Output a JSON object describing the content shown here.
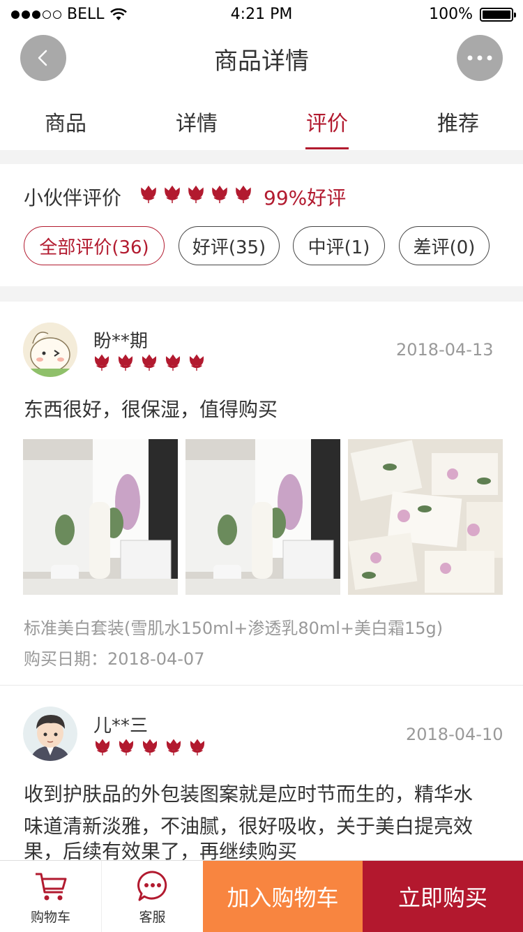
{
  "status_bar": {
    "carrier": "BELL",
    "time": "4:21 PM",
    "battery": "100%"
  },
  "nav": {
    "title": "商品详情"
  },
  "tabs": [
    {
      "label": "商品"
    },
    {
      "label": "详情"
    },
    {
      "label": "评价",
      "active": true
    },
    {
      "label": "推荐"
    }
  ],
  "summary": {
    "label": "小伙伴评价",
    "rating": 5,
    "good_rate": "99%好评"
  },
  "filters": [
    {
      "label": "全部评价(36)",
      "active": true
    },
    {
      "label": "好评(35)"
    },
    {
      "label": "中评(1)"
    },
    {
      "label": "差评(0)"
    }
  ],
  "reviews": [
    {
      "name": "盼**期",
      "date": "2018-04-13",
      "rating": 5,
      "text": "东西很好，很保湿，值得购买",
      "spec": "标准美白套装(雪肌水150ml+渗透乳80ml+美白霜15g)",
      "purchase_date": "购买日期：2018-04-07"
    },
    {
      "name": "儿**三",
      "date": "2018-04-10",
      "rating": 5,
      "text_lines": [
        "收到护肤品的外包装图案就是应时节而生的，精华水",
        "味道清新淡雅，不油腻，很好吸收，关于美白提亮效",
        "果，后续有效果了，再继续购买"
      ]
    }
  ],
  "bottom_bar": {
    "cart_label": "购物车",
    "service_label": "客服",
    "add_to_cart": "加入购物车",
    "buy_now": "立即购买"
  },
  "colors": {
    "accent": "#b21a2f",
    "orange": "#f88540",
    "buy": "#b3182e",
    "muted": "#999999"
  },
  "icons": [
    "back-arrow-icon",
    "more-dots-icon",
    "tulip-icon",
    "cart-icon",
    "chat-icon",
    "wifi-icon",
    "battery-icon"
  ]
}
